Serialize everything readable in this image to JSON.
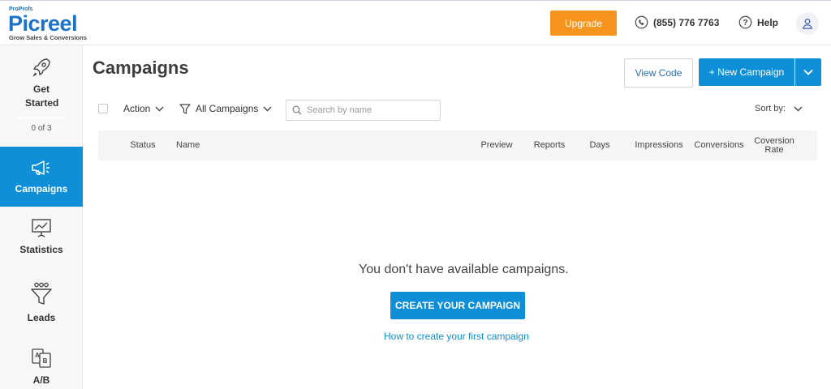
{
  "logo": {
    "company": "ProProfs",
    "brand": "Picreel",
    "tagline": "Grow Sales & Conversions"
  },
  "header": {
    "upgrade_label": "Upgrade",
    "phone": "(855) 776 7763",
    "help_label": "Help"
  },
  "sidebar": {
    "items": [
      {
        "label": "Get Started",
        "progress": "0 of 3",
        "icon": "rocket-icon"
      },
      {
        "label": "Campaigns",
        "icon": "megaphone-icon",
        "active": true
      },
      {
        "label": "Statistics",
        "icon": "chart-board-icon"
      },
      {
        "label": "Leads",
        "icon": "funnel-icon"
      },
      {
        "label": "A/B",
        "icon": "ab-test-icon"
      }
    ]
  },
  "main": {
    "title": "Campaigns",
    "view_code_label": "View Code",
    "new_campaign_label": "+ New Campaign",
    "toolbar": {
      "action_label": "Action",
      "filter_label": "All Campaigns",
      "search_placeholder": "Search by name",
      "sort_label": "Sort by:"
    },
    "columns": [
      "Status",
      "Name",
      "Preview",
      "Reports",
      "Days",
      "Impressions",
      "Conversions",
      "Coversion Rate"
    ],
    "empty_message": "You don't have available campaigns.",
    "create_label": "CREATE YOUR CAMPAIGN",
    "howto_label": "How to create your first campaign"
  },
  "colors": {
    "accent": "#0e8fd8",
    "upgrade": "#f7941d",
    "brand": "#1a73c9"
  }
}
